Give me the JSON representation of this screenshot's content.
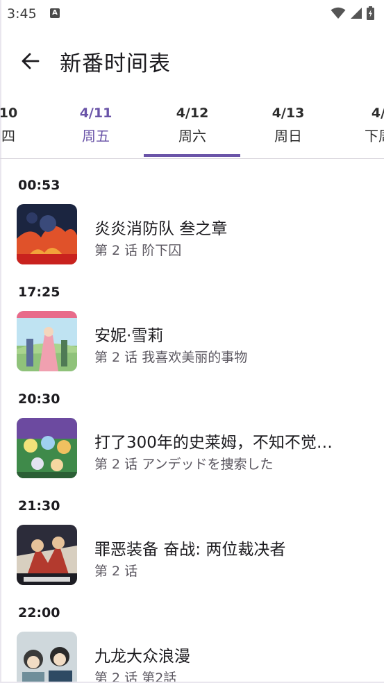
{
  "status_bar": {
    "time": "3:45",
    "notification_glyph": "A",
    "icons": [
      "wifi-icon",
      "cell-signal-icon",
      "battery-icon"
    ]
  },
  "header": {
    "title": "新番时间表",
    "back_icon": "arrow-left-icon"
  },
  "tabs": [
    {
      "date": "10",
      "weekday": "四",
      "selected": false
    },
    {
      "date": "4/11",
      "weekday": "周五",
      "selected": false
    },
    {
      "date": "4/12",
      "weekday": "周六",
      "selected": true
    },
    {
      "date": "4/13",
      "weekday": "周日",
      "selected": false
    },
    {
      "date": "4/",
      "weekday": "下周",
      "selected": false
    }
  ],
  "accent_color": "#6a54a8",
  "schedule": [
    {
      "time": "00:53",
      "title": "炎炎消防队 叁之章",
      "episode": "第 2 话  阶下囚"
    },
    {
      "time": "17:25",
      "title": "安妮·雪莉",
      "episode": "第 2 话  我喜欢美丽的事物"
    },
    {
      "time": "20:30",
      "title": "打了300年的史莱姆，不知不觉…",
      "episode": "第 2 话  アンデッドを捜索した"
    },
    {
      "time": "21:30",
      "title": "罪恶装备 奋战: 两位裁决者",
      "episode": "第 2 话"
    },
    {
      "time": "22:00",
      "title": "九龙大众浪漫",
      "episode": "第 2 话  第2話"
    }
  ]
}
